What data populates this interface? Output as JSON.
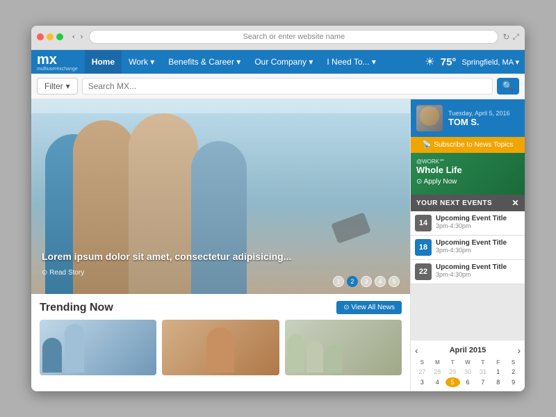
{
  "browser": {
    "address": "Search or enter website name"
  },
  "nav": {
    "logo_main": "mx",
    "logo_sub": "multiuserexchange",
    "items": [
      {
        "label": "Home",
        "active": true
      },
      {
        "label": "Work ▾",
        "active": false
      },
      {
        "label": "Benefits & Career ▾",
        "active": false
      },
      {
        "label": "Our Company ▾",
        "active": false
      },
      {
        "label": "I Need To... ▾",
        "active": false
      }
    ],
    "weather_icon": "☀",
    "temperature": "75°",
    "location": "Springfield, MA ▾"
  },
  "search": {
    "filter_label": "Filter",
    "filter_chevron": "▾",
    "placeholder": "Search MX...",
    "search_icon": "🔍"
  },
  "hero": {
    "caption_title": "Lorem ipsum dolor sit amet, consectetur adipisicing...",
    "read_story": "Read Story",
    "pages": [
      "1",
      "2",
      "3",
      "4",
      "5"
    ],
    "active_page": 2
  },
  "trending": {
    "title": "Trending Now",
    "view_all_label": "⊙ View All News"
  },
  "user_panel": {
    "date": "Tuesday, April 5, 2016",
    "name": "TOM S.",
    "subscribe_label": "Subscribe to News Topics"
  },
  "whole_life": {
    "tag": "@WORK℠",
    "title": "Whole Life",
    "apply_label": "⊙ Apply Now"
  },
  "next_events": {
    "section_title": "YOUR NEXT EVENTS",
    "close_icon": "✕",
    "events": [
      {
        "date": "14",
        "color": "gray",
        "title": "Upcoming Event Title",
        "time": "3pm-4:30pm"
      },
      {
        "date": "18",
        "color": "blue",
        "title": "Upcoming Event Title",
        "time": "3pm-4:30pm"
      },
      {
        "date": "22",
        "color": "gray",
        "title": "Upcoming Event Title",
        "time": "3pm-4:30pm"
      }
    ]
  },
  "calendar": {
    "prev": "‹",
    "next": "›",
    "month_year": "April 2015",
    "day_headers": [
      "S",
      "M",
      "T",
      "W",
      "T",
      "F",
      "S"
    ],
    "weeks": [
      [
        "27",
        "28",
        "29",
        "30",
        "31",
        "1",
        "2"
      ],
      [
        "3",
        "4",
        "5",
        "6",
        "7",
        "8",
        "9"
      ]
    ],
    "today": "5",
    "empty_days": [
      "27",
      "28",
      "29",
      "30",
      "31"
    ]
  }
}
